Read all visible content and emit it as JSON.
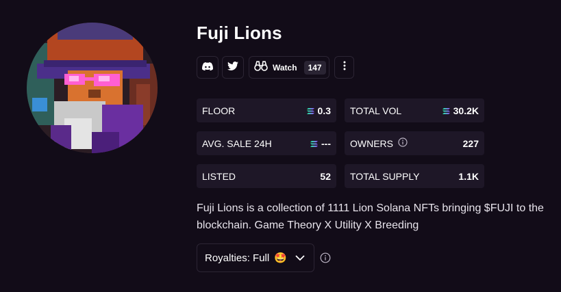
{
  "collection": {
    "name": "Fuji Lions",
    "description": "Fuji Lions is a collection of 1111 Lion Solana NFTs bringing $FUJI to the blockchain. Game Theory X Utility X Breeding"
  },
  "actions": {
    "discord_icon": "discord-icon",
    "twitter_icon": "twitter-icon",
    "watch_label": "Watch",
    "watch_count": "147",
    "more_icon": "more-vertical-icon"
  },
  "stats": {
    "floor": {
      "label": "FLOOR",
      "value": "0.3"
    },
    "total_vol": {
      "label": "TOTAL VOL",
      "value": "30.2K"
    },
    "avg_sale": {
      "label": "AVG. SALE 24H",
      "value": "---"
    },
    "owners": {
      "label": "OWNERS",
      "value": "227"
    },
    "listed": {
      "label": "LISTED",
      "value": "52"
    },
    "total_supply": {
      "label": "TOTAL SUPPLY",
      "value": "1.1K"
    }
  },
  "royalties": {
    "label": "Royalties: Full",
    "emoji": "🤩"
  },
  "colors": {
    "background": "#120c18",
    "stat_card": "#1e1727",
    "sol_gradient": [
      "#9945ff",
      "#19fb9b"
    ],
    "border": "#2c2534"
  }
}
